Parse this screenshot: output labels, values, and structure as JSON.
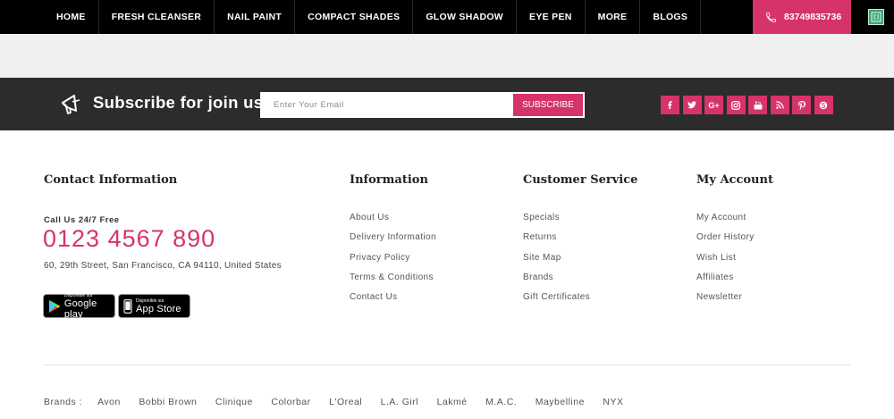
{
  "nav": {
    "items": [
      "HOME",
      "FRESH CLEANSER",
      "NAIL PAINT",
      "COMPACT SHADES",
      "GLOW SHADOW",
      "EYE PEN",
      "MORE",
      "BLOGS"
    ],
    "phone": "83749835736"
  },
  "subscribe": {
    "title": "Subscribe for join us!",
    "placeholder": "Enter Your Email",
    "button": "SUBSCRIBE",
    "socials": [
      "facebook-icon",
      "twitter-icon",
      "google-plus-icon",
      "instagram-icon",
      "youtube-icon",
      "rss-icon",
      "pinterest-icon",
      "skype-icon"
    ]
  },
  "contact": {
    "title": "Contact Information",
    "call_label": "Call Us 24/7 Free",
    "phone": "0123 4567 890",
    "address": "60, 29th Street, San Francisco, CA 94110, United States",
    "google_play": {
      "small": "Disponible sur",
      "big": "Google play"
    },
    "app_store": {
      "small": "Disponible sur",
      "big": "App Store"
    }
  },
  "information": {
    "title": "Information",
    "links": [
      "About Us",
      "Delivery Information",
      "Privacy Policy",
      "Terms & Conditions",
      "Contact Us"
    ]
  },
  "customer_service": {
    "title": "Customer Service",
    "links": [
      "Specials",
      "Returns",
      "Site Map",
      "Brands",
      "Gift Certificates"
    ]
  },
  "my_account": {
    "title": "My Account",
    "links": [
      "My Account",
      "Order History",
      "Wish List",
      "Affiliates",
      "Newsletter"
    ]
  },
  "brands": {
    "label": "Brands :",
    "items": [
      "Avon",
      "Bobbi Brown",
      "Clinique",
      "Colorbar",
      "L'Oreal",
      "L.A. Girl",
      "Lakmé",
      "M.A.C.",
      "Maybelline",
      "NYX"
    ]
  },
  "colors": {
    "accent": "#d6336c",
    "nav_bg": "#000000",
    "subscribe_bg": "#2c2c2c"
  }
}
